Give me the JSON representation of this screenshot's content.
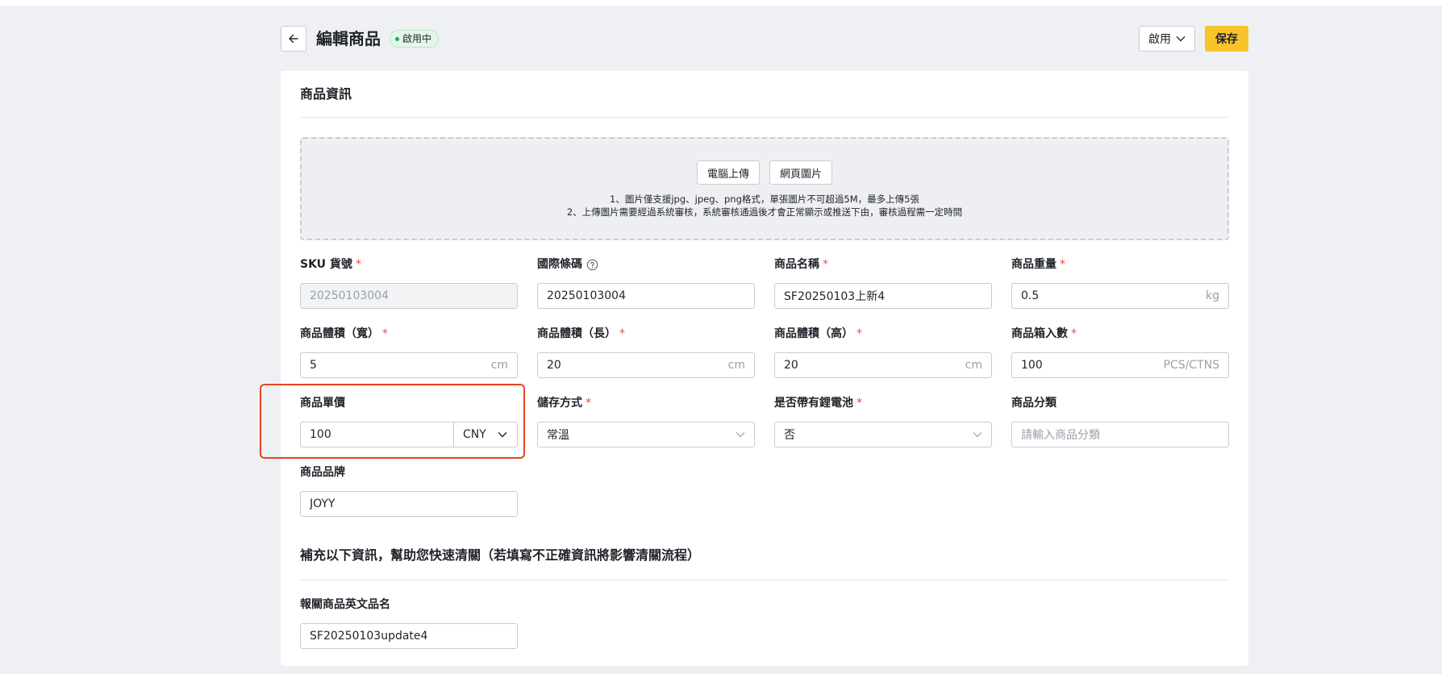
{
  "header": {
    "title": "編輯商品",
    "status_badge": "啟用中",
    "status_select": "啟用",
    "save_label": "保存"
  },
  "section1": {
    "title": "商品資訊"
  },
  "upload": {
    "computer_upload_label": "電腦上傳",
    "web_image_label": "網頁圖片",
    "hint_1": "1、圖片僅支援jpg、jpeg、png格式，單張圖片不可超過5M，最多上傳5張",
    "hint_2": "2、上傳圖片需要經過系統審核，系統審核通過後才會正常顯示或推送下由，審核過程需一定時間"
  },
  "fields": {
    "sku": {
      "label": "SKU 貨號",
      "value": "20250103004"
    },
    "barcode": {
      "label": "國際條碼",
      "value": "20250103004"
    },
    "name": {
      "label": "商品名稱",
      "value": "SF20250103上新4"
    },
    "weight": {
      "label": "商品重量",
      "value": "0.5",
      "unit": "kg"
    },
    "width": {
      "label": "商品體積（寬）",
      "value": "5",
      "unit": "cm"
    },
    "length": {
      "label": "商品體積（長）",
      "value": "20",
      "unit": "cm"
    },
    "height": {
      "label": "商品體積（高）",
      "value": "20",
      "unit": "cm"
    },
    "box_qty": {
      "label": "商品箱入數",
      "value": "100",
      "unit": "PCS/CTNS"
    },
    "price": {
      "label": "商品單價",
      "value": "100",
      "currency": "CNY"
    },
    "storage": {
      "label": "儲存方式",
      "value": "常溫"
    },
    "battery": {
      "label": "是否帶有鋰電池",
      "value": "否"
    },
    "category": {
      "label": "商品分類",
      "placeholder": "請輸入商品分類"
    },
    "brand": {
      "label": "商品品牌",
      "value": "JOYY"
    }
  },
  "section2": {
    "title": "補充以下資訊，幫助您快速清關（若填寫不正確資訊將影響清關流程）",
    "en_name": {
      "label": "報關商品英文品名",
      "value": "SF20250103update4"
    }
  },
  "colors": {
    "accent": "#f8c42c",
    "required": "#e84d3d",
    "highlight": "#e8441f",
    "badge_bg": "#e4f7ea"
  }
}
